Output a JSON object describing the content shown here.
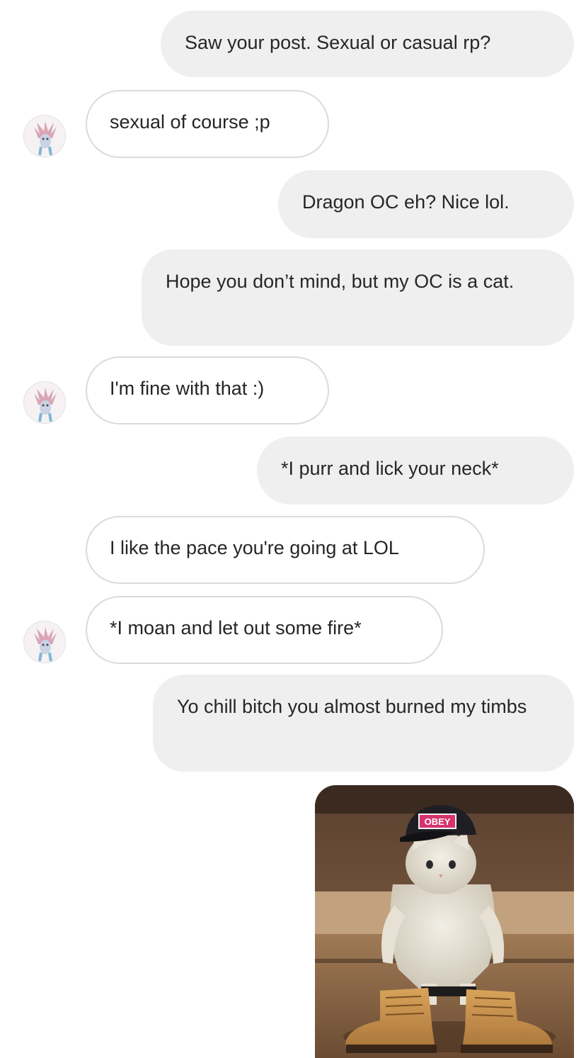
{
  "messages": [
    {
      "id": "m1",
      "side": "sent",
      "text": "Saw your post. Sexual or casual rp?"
    },
    {
      "id": "m2",
      "side": "received",
      "text": "sexual of course ;p"
    },
    {
      "id": "m3",
      "side": "sent",
      "text": "Dragon OC eh? Nice lol."
    },
    {
      "id": "m4",
      "side": "sent",
      "text": "Hope you don’t mind, but my OC is a cat."
    },
    {
      "id": "m5",
      "side": "received",
      "text": "I'm fine with that :)"
    },
    {
      "id": "m6",
      "side": "sent",
      "text": "*I purr and lick your neck*"
    },
    {
      "id": "m7",
      "side": "received",
      "text": "I like the pace you're going at LOL"
    },
    {
      "id": "m8",
      "side": "received",
      "text": "*I moan and let out some fire*"
    },
    {
      "id": "m9",
      "side": "sent",
      "text": "Yo chill bitch you almost burned my timbs"
    }
  ],
  "photo": {
    "cap_text": "OBEY"
  },
  "colors": {
    "sent_bubble": "#efefef",
    "received_border": "#dbdbdb",
    "text": "#262626"
  }
}
